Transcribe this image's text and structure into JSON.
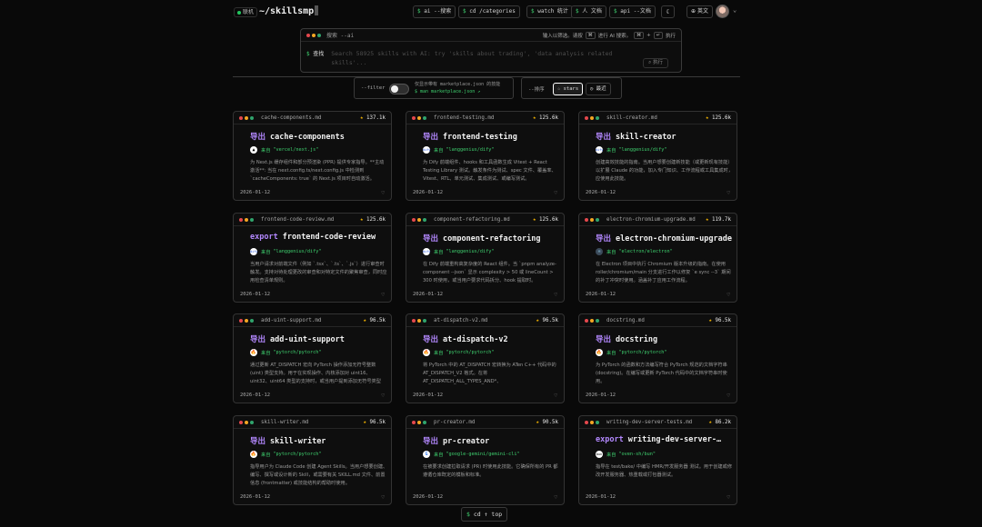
{
  "header": {
    "status": "联机",
    "brand": "~/skillsmp",
    "nav": [
      {
        "prefix": "$",
        "label": "ai --搜索"
      },
      {
        "prefix": "$",
        "label": "cd /categories"
      },
      {
        "prefix": "$",
        "label": "watch 统计"
      },
      {
        "prefix": "$",
        "label": "人 文档"
      },
      {
        "prefix": "$",
        "label": "api --文档"
      }
    ],
    "theme_icon": "☾",
    "lang": "英文",
    "lang_icon": "⊕",
    "avatar_icon": "avatar",
    "chevron": "⌄"
  },
  "search": {
    "tab": "搜索 --ai",
    "hint_pre": "输入以筛选。请按",
    "hint_key1": "⌘",
    "hint_mid": "进行 AI 搜索。",
    "hint_key2": "⌘",
    "hint_plus": "+",
    "hint_key3": "↵",
    "hint_post": "执行",
    "prompt_symbol": "$",
    "prompt_label": "查找",
    "placeholder": "Search 58925 skills with AI: try 'skills about trading', 'data analysis related skills'...",
    "exec_label": "执行"
  },
  "filter": {
    "label": "--filter",
    "desc1": "仅显示带有 marketplace.json 的技能",
    "desc2": "$ man marketplace.json"
  },
  "sort": {
    "label": "--排序",
    "options": [
      {
        "label": "stars",
        "icon": "☆",
        "active": true
      },
      {
        "label": "最近",
        "icon": "◷",
        "active": false
      }
    ]
  },
  "cards": [
    {
      "file": "cache-components.md",
      "stars": "137.1k",
      "kw": "导出",
      "title": "cache-components",
      "src_label": "来自",
      "src": "\"vercel/next.js\"",
      "src_icon": "▲",
      "desc": "为 Next.js 缓存组件和部分预渲染 (PPR) 提供专家指导。**主动激活**: 当在 next.config.ts/next.config.js 中检测到 `cacheComponents: true` 的 Next.js 项目时自动激活。",
      "date": "2026-01-12"
    },
    {
      "file": "frontend-testing.md",
      "stars": "125.6k",
      "kw": "导出",
      "title": "frontend-testing",
      "src_label": "来自",
      "src": "\"langgenius/dify\"",
      "src_icon": "dify",
      "desc": "为 Dify 前端组件、hooks 和工具函数生成 Vitest + React Testing Library 测试。触发条件为测试、spec 文件、覆盖率、Vitest、RTL、单元测试、集成测试、或编写测试。",
      "date": "2026-01-12"
    },
    {
      "file": "skill-creator.md",
      "stars": "125.6k",
      "kw": "导出",
      "title": "skill-creator",
      "src_label": "来自",
      "src": "\"langgenius/dify\"",
      "src_icon": "dify",
      "desc": "创建高效技能的指南。当用户想要创建新技能（或更新现有技能）以扩展 Claude 的功能，加入专门知识、工作流程或工具集成时，应使用此技能。",
      "date": "2026-01-12"
    },
    {
      "file": "frontend-code-review.md",
      "stars": "125.6k",
      "kw": "export",
      "title": "frontend-code-review",
      "src_label": "来自",
      "src": "\"langgenius/dify\"",
      "src_icon": "dify",
      "desc": "当用户请求对前端文件（例如 `.tsx`、`.ts`、`.js`）进行审查时触发。支持对待处理更改的审查和对特定文件的聚焦审查，同时应用检查清单规则。",
      "date": "2026-01-12"
    },
    {
      "file": "component-refactoring.md",
      "stars": "125.6k",
      "kw": "导出",
      "title": "component-refactoring",
      "src_label": "来自",
      "src": "\"langgenius/dify\"",
      "src_icon": "dify",
      "desc": "在 Dify 前端重构高复杂度的 React 组件。当 `pnpm analyze-component --json` 显示 complexity > 50 或 lineCount > 300 时使用，或当用户要求代码拆分、hook 提取时。",
      "date": "2026-01-12"
    },
    {
      "file": "electron-chromium-upgrade.md",
      "stars": "119.7k",
      "kw": "导出",
      "title": "electron-chromium-upgrade",
      "src_label": "来自",
      "src": "\"electron/electron\"",
      "src_icon": "⚛",
      "desc": "在 Electron 项目中执行 Chromium 版本升级的指南。在使用 roller/chromium/main 分支进行工作以修复 `e sync --3` 期间的补丁冲突时使用。涵盖补丁应用工作流程。",
      "date": "2026-01-12"
    },
    {
      "file": "add-uint-support.md",
      "stars": "96.5k",
      "kw": "导出",
      "title": "add-uint-support",
      "src_label": "来自",
      "src": "\"pytorch/pytorch\"",
      "src_icon": "🔥",
      "desc": "通过更新 AT_DISPATCH 宏向 PyTorch 操作添加无符号整数 (uint) 类型支持。用于在实现操作、内核添加对 uint16、uint32、uint64 类型的支持时，或当用户提到添加无符号类型时。",
      "date": "2026-01-12"
    },
    {
      "file": "at-dispatch-v2.md",
      "stars": "96.5k",
      "kw": "导出",
      "title": "at-dispatch-v2",
      "src_label": "来自",
      "src": "\"pytorch/pytorch\"",
      "src_icon": "🔥",
      "desc": "将 PyTorch 中的 AT_DISPATCH 宏转换为 ATen C++ 代码中的 AT_DISPATCH_V2 格式。在将 AT_DISPATCH_ALL_TYPES_AND*、AT_DISPATCH_FLOATING_TYPES* 转换时使用。",
      "date": "2026-01-12"
    },
    {
      "file": "docstring.md",
      "stars": "96.5k",
      "kw": "导出",
      "title": "docstring",
      "src_label": "来自",
      "src": "\"pytorch/pytorch\"",
      "src_icon": "🔥",
      "desc": "为 PyTorch 的函数和方法编写符合 PyTorch 规范的文档字符串 (docstring)。在编写或更新 PyTorch 代码中的文档字符串时使用。",
      "date": "2026-01-12"
    },
    {
      "file": "skill-writer.md",
      "stars": "96.5k",
      "kw": "导出",
      "title": "skill-writer",
      "src_label": "来自",
      "src": "\"pytorch/pytorch\"",
      "src_icon": "🔥",
      "desc": "指导用户为 Claude Code 创建 Agent Skills。当用户想要创建、编写、撰写或设计新的 Skill，或需要有关 SKILL.md 文件、前置信息 (frontmatter) 或技能结构的帮助时使用。",
      "date": "2026-01-12"
    },
    {
      "file": "pr-creator.md",
      "stars": "90.5k",
      "kw": "导出",
      "title": "pr-creator",
      "src_label": "来自",
      "src": "\"google-gemini/gemini-cli\"",
      "src_icon": "G",
      "desc": "在被要求创建拉取请求 (PR) 时使用此技能。它确保所有的 PR 都遵循仓库既定的模板和标准。",
      "date": "2026-01-12"
    },
    {
      "file": "writing-dev-server-tests.md",
      "stars": "86.2k",
      "kw": "export",
      "title": "writing-dev-server-…",
      "src_label": "来自",
      "src": "\"oven-sh/bun\"",
      "src_icon": "bun",
      "desc": "指导在 test/bake/ 中编写 HMR/开发服务器 测试。用于创建或修改开发服务器、热重载或打包器测试。",
      "date": "2026-01-12"
    }
  ],
  "bottom": {
    "prefix": "$",
    "label": "cd ↑ top"
  }
}
